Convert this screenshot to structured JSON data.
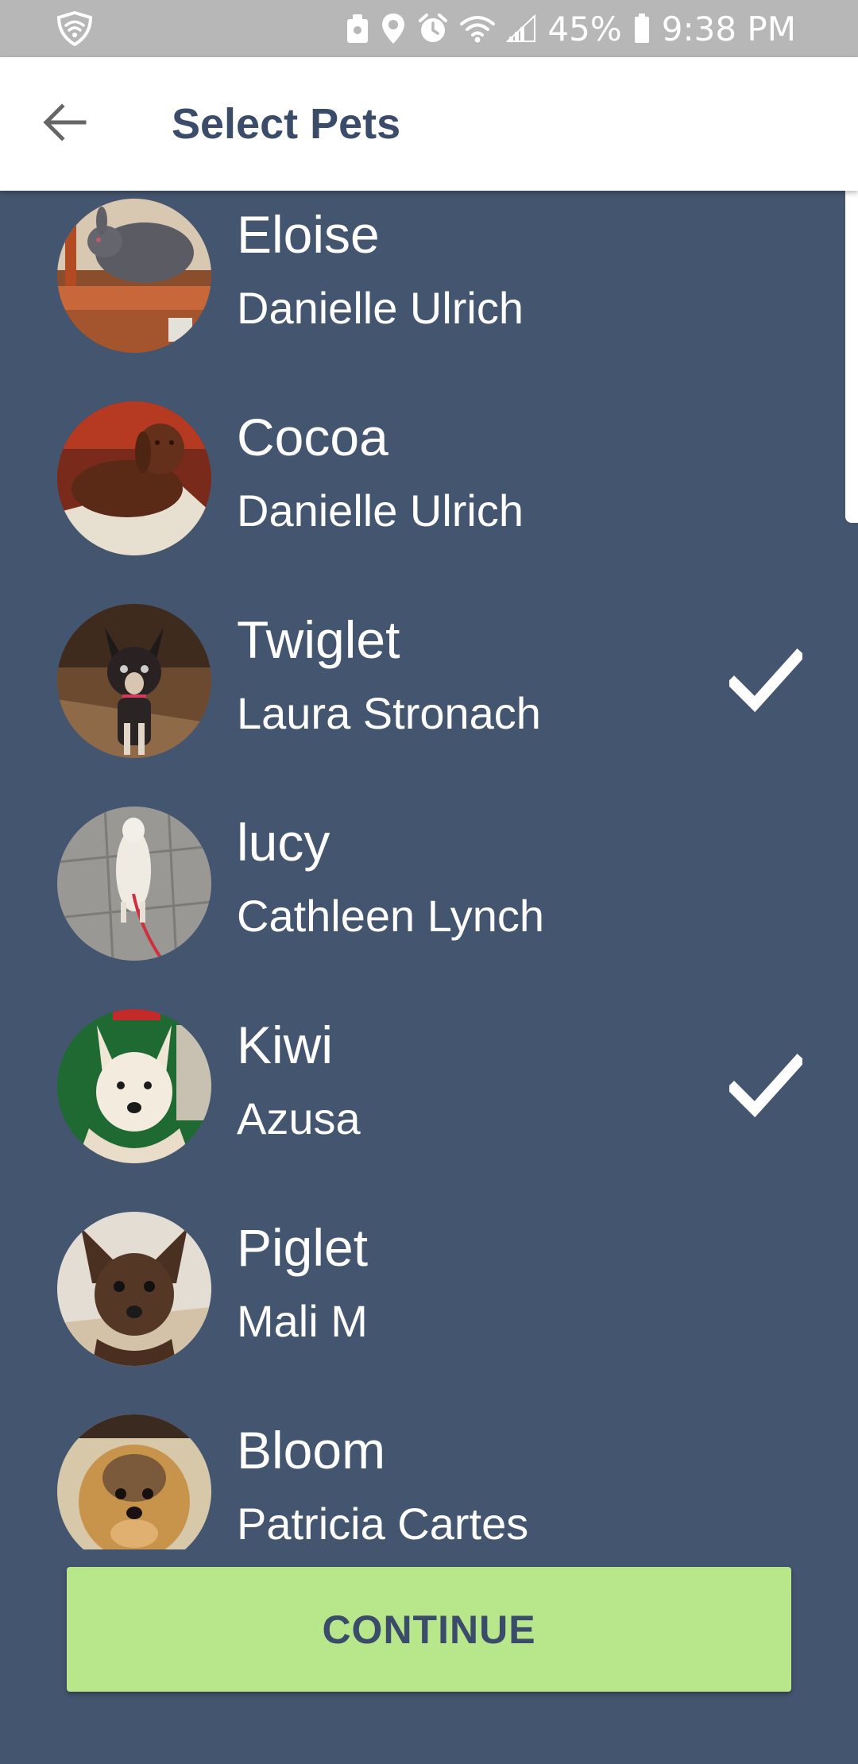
{
  "status_bar": {
    "battery": "45%",
    "time": "9:38 PM"
  },
  "header": {
    "title": "Select Pets"
  },
  "pets": [
    {
      "name": "Eloise",
      "owner": "Danielle Ulrich",
      "selected": false
    },
    {
      "name": "Cocoa",
      "owner": "Danielle Ulrich",
      "selected": false
    },
    {
      "name": "Twiglet",
      "owner": "Laura Stronach",
      "selected": true
    },
    {
      "name": "lucy",
      "owner": "Cathleen Lynch",
      "selected": false
    },
    {
      "name": "Kiwi",
      "owner": "Azusa",
      "selected": true
    },
    {
      "name": "Piglet",
      "owner": "Mali M",
      "selected": false
    },
    {
      "name": "Bloom",
      "owner": "Patricia Cartes",
      "selected": false
    }
  ],
  "footer": {
    "continue_label": "CONTINUE"
  },
  "colors": {
    "background": "#44556f",
    "title_text": "#3b4c6b",
    "button": "#b8e68a",
    "status_bar": "#b7b7b7"
  }
}
